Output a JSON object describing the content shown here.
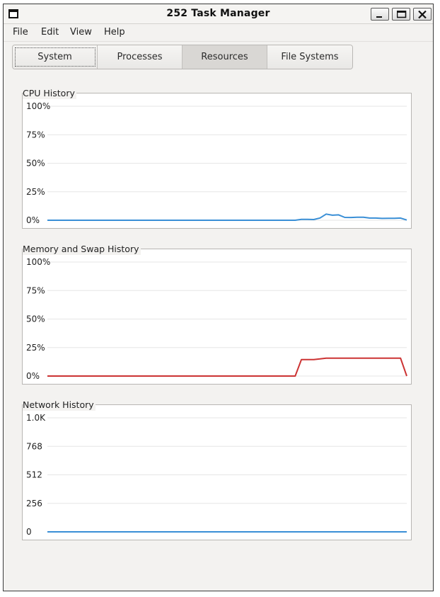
{
  "window": {
    "title": "252 Task Manager"
  },
  "menu": [
    "File",
    "Edit",
    "View",
    "Help"
  ],
  "tabs": [
    {
      "label": "System",
      "focused": true,
      "selected": false
    },
    {
      "label": "Processes",
      "focused": false,
      "selected": false
    },
    {
      "label": "Resources",
      "focused": false,
      "selected": true
    },
    {
      "label": "File Systems",
      "focused": false,
      "selected": false
    }
  ],
  "charts": [
    {
      "title": "CPU History",
      "ticks": [
        "100%",
        "75%",
        "50%",
        "25%",
        "0%"
      ],
      "color": "#3a8fd6",
      "ymax": 100,
      "values": [
        0,
        0,
        0,
        0,
        0,
        0,
        0,
        0,
        0,
        0,
        0,
        0,
        0,
        0,
        0,
        0,
        0,
        0,
        0,
        0,
        0,
        0,
        0,
        0,
        0,
        0,
        0,
        0,
        0,
        0,
        0,
        0,
        0,
        0,
        0,
        0,
        0,
        0,
        0,
        0,
        0,
        0.8,
        0.8,
        0.6,
        2,
        5.4,
        4.4,
        4.7,
        2.5,
        2.4,
        2.6,
        2.6,
        1.9,
        1.9,
        1.6,
        1.7,
        1.7,
        1.9,
        0.2
      ]
    },
    {
      "title": "Memory and Swap History",
      "ticks": [
        "100%",
        "75%",
        "50%",
        "25%",
        "0%"
      ],
      "color": "#cc3333",
      "ymax": 100,
      "values": [
        0,
        0,
        0,
        0,
        0,
        0,
        0,
        0,
        0,
        0,
        0,
        0,
        0,
        0,
        0,
        0,
        0,
        0,
        0,
        0,
        0,
        0,
        0,
        0,
        0,
        0,
        0,
        0,
        0,
        0,
        0,
        0,
        0,
        0,
        0,
        0,
        0,
        0,
        0,
        0,
        0,
        14.5,
        14.5,
        14.5,
        15,
        15.7,
        15.7,
        15.7,
        15.7,
        15.7,
        15.7,
        15.7,
        15.7,
        15.7,
        15.7,
        15.7,
        15.7,
        15.7,
        0
      ]
    },
    {
      "title": "Network History",
      "ticks": [
        "1.0K",
        "768",
        "512",
        "256",
        "0"
      ],
      "color": "#3a8fd6",
      "ymax": 1024,
      "values": [
        0,
        0,
        0,
        0,
        0,
        0,
        0,
        0,
        0,
        0,
        0,
        0,
        0,
        0,
        0,
        0,
        0,
        0,
        0,
        0,
        0,
        0,
        0,
        0,
        0,
        0,
        0,
        0,
        0,
        0,
        0,
        0,
        0,
        0,
        0,
        0,
        0,
        0,
        0,
        0,
        0,
        0,
        0,
        0,
        0,
        0,
        0,
        0,
        0,
        0,
        0,
        0,
        0,
        0,
        0,
        0,
        0,
        0,
        0
      ]
    }
  ]
}
